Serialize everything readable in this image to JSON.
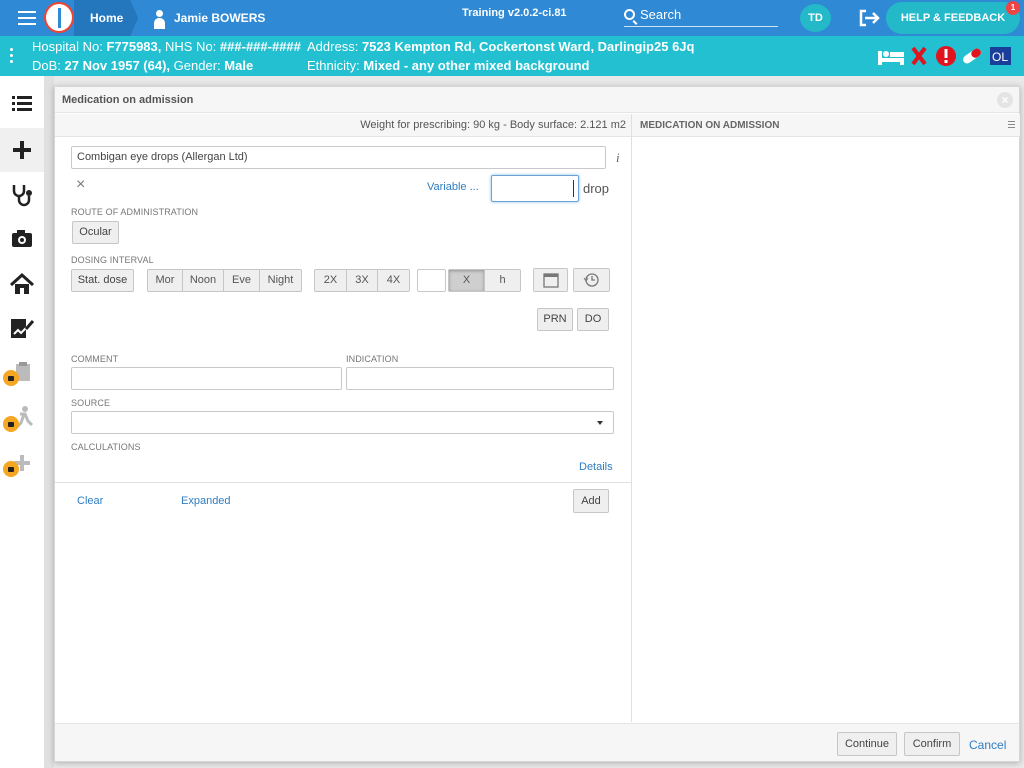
{
  "topbar": {
    "home": "Home",
    "patient_name": "Jamie BOWERS",
    "version": "Training v2.0.2-ci.81",
    "search": "Search",
    "user_initials": "TD",
    "help": "HELP & FEEDBACK",
    "help_badge": "1"
  },
  "banner": {
    "hospital_label": "Hospital No:",
    "hospital_no": "F775983,",
    "nhs_label": "NHS No:",
    "nhs_no": "###-###-####",
    "address_label": "Address:",
    "address": "7523 Kempton Rd, Cockertonst Ward, Darlingip25 6Jq",
    "dob_label": "DoB:",
    "dob": "27 Nov 1957 (64),",
    "gender_label": "Gender:",
    "gender": "Male",
    "ethnicity_label": "Ethnicity:",
    "ethnicity": "Mixed - any other mixed background",
    "ol": "OL"
  },
  "modal": {
    "title": "Medication on admission",
    "close": "×",
    "weight": "Weight for prescribing: 90 kg - Body surface: 2.121 m2",
    "medication_value": "Combigan eye drops (Allergan Ltd)",
    "clear_x": "×",
    "variable": "Variable ...",
    "dose_value": "",
    "dose_unit": "drop",
    "route_label": "ROUTE OF ADMINISTRATION",
    "route_value": "Ocular",
    "dosing_label": "DOSING INTERVAL",
    "stat_dose": "Stat. dose",
    "times": [
      "Mor",
      "Noon",
      "Eve",
      "Night"
    ],
    "freq": [
      "2X",
      "3X",
      "4X"
    ],
    "interval_x": "X",
    "interval_h": "h",
    "prn": "PRN",
    "do": "DO",
    "comment_label": "COMMENT",
    "indication_label": "INDICATION",
    "source_label": "SOURCE",
    "calculations_label": "CALCULATIONS",
    "details": "Details",
    "clear": "Clear",
    "expanded": "Expanded",
    "add": "Add",
    "right_header": "MEDICATION ON ADMISSION"
  },
  "footer": {
    "continue": "Continue",
    "confirm": "Confirm",
    "cancel": "Cancel"
  }
}
